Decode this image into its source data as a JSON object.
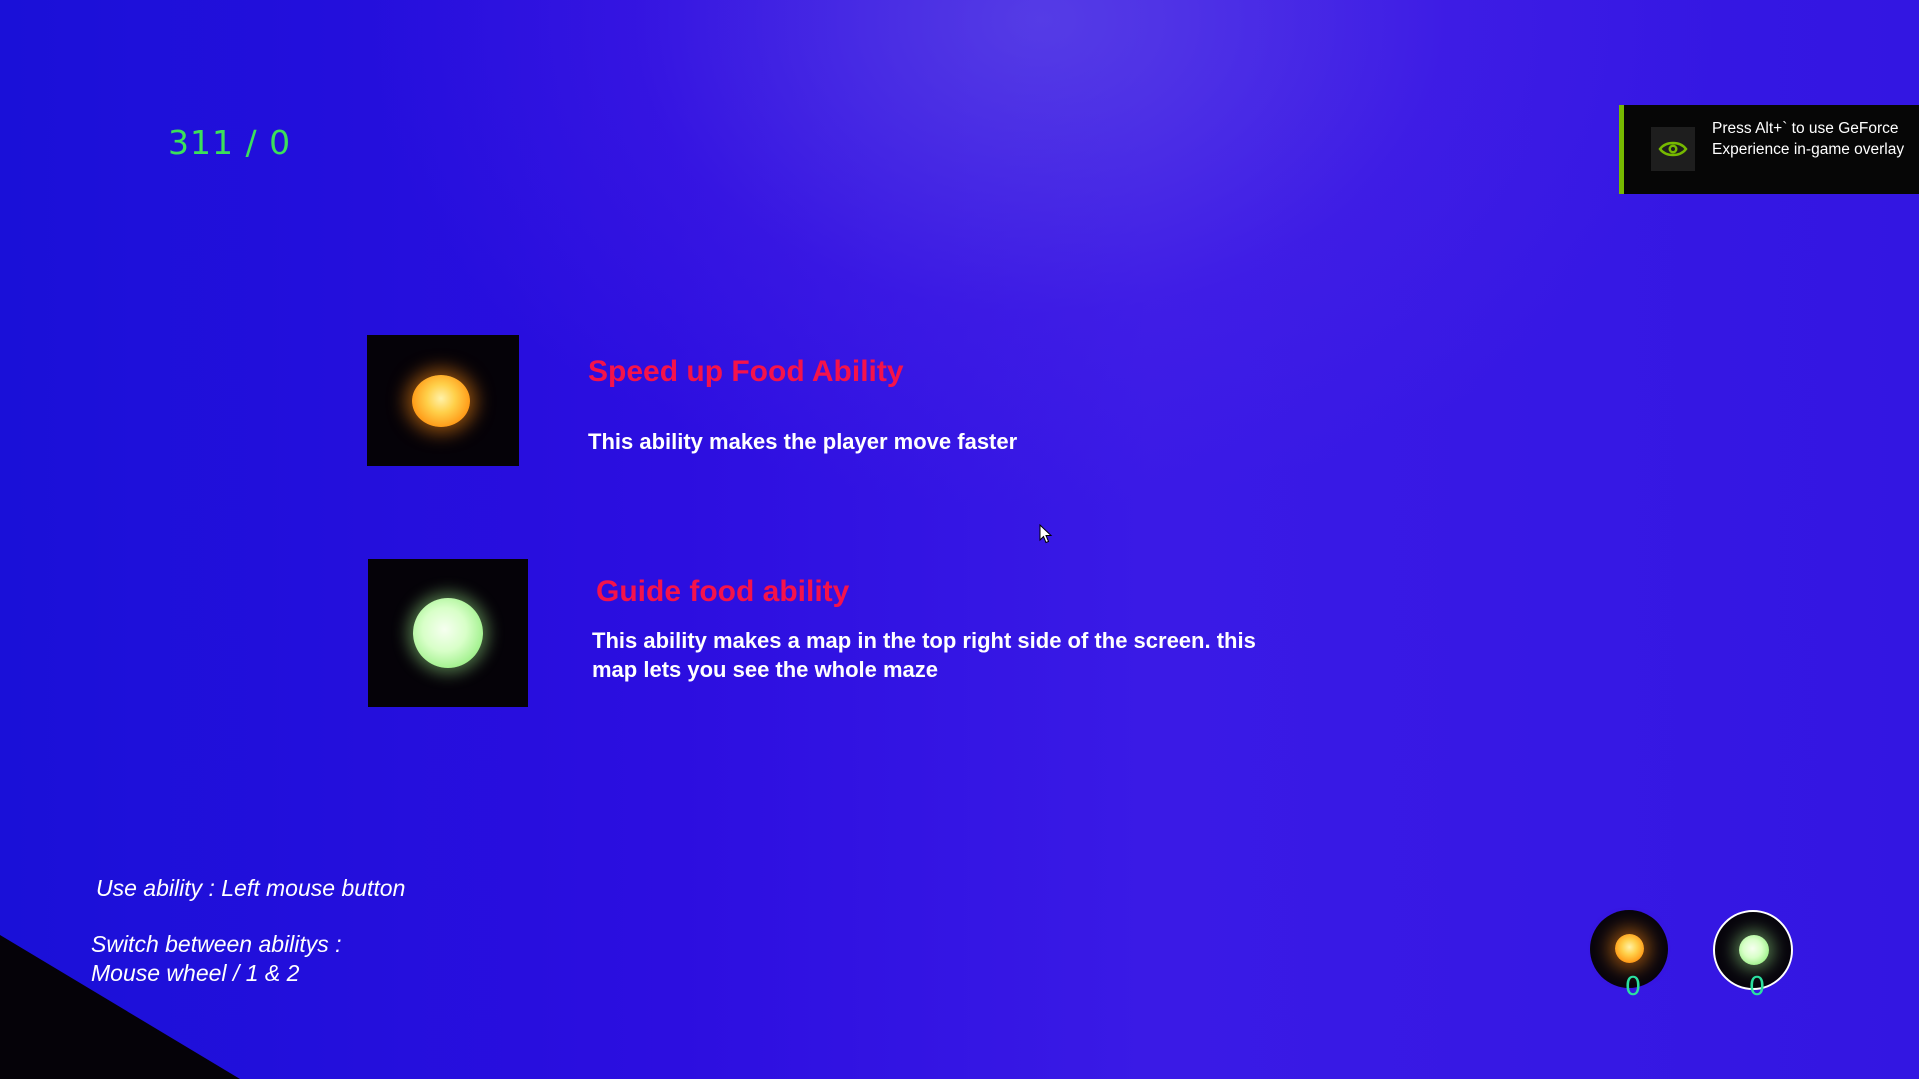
{
  "hud": {
    "score": "311 / 0"
  },
  "overlay_toast": {
    "text": "Press Alt+` to use GeForce Experience in-game overlay",
    "icon": "nvidia-eye-icon",
    "accent_color": "#76b900"
  },
  "abilities": [
    {
      "icon": "orange-orb-icon",
      "title": "Speed up Food Ability",
      "description": "This ability makes the player move faster"
    },
    {
      "icon": "green-orb-icon",
      "title": "Guide food ability",
      "description": "This ability makes a map in the top right side of the screen. this map lets you see the whole maze"
    }
  ],
  "controls": {
    "use_ability": "Use ability : Left mouse button",
    "switch_line1": "Switch between abilitys :",
    "switch_line2": "Mouse wheel / 1 & 2"
  },
  "ability_slots": [
    {
      "icon": "orange-orb-icon",
      "count": "0",
      "selected": false
    },
    {
      "icon": "green-orb-icon",
      "count": "0",
      "selected": true
    }
  ],
  "colors": {
    "title": "#f5124a",
    "score": "#3ce05a",
    "slot_count": "#2be0a0"
  }
}
